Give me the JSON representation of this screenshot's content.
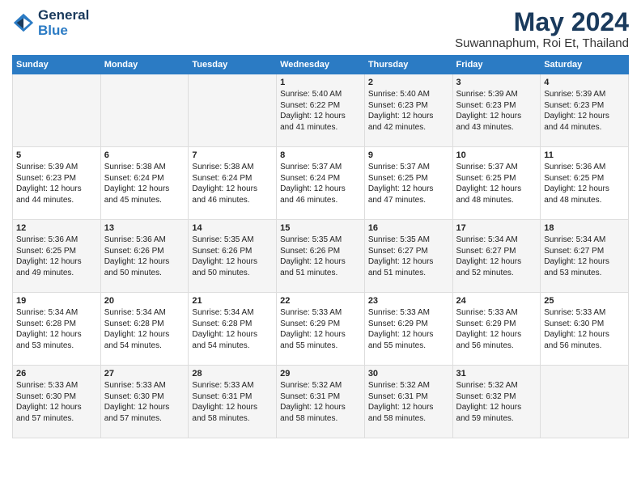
{
  "logo": {
    "line1": "General",
    "line2": "Blue"
  },
  "title": "May 2024",
  "subtitle": "Suwannaphum, Roi Et, Thailand",
  "days_of_week": [
    "Sunday",
    "Monday",
    "Tuesday",
    "Wednesday",
    "Thursday",
    "Friday",
    "Saturday"
  ],
  "weeks": [
    [
      {
        "day": "",
        "info": ""
      },
      {
        "day": "",
        "info": ""
      },
      {
        "day": "",
        "info": ""
      },
      {
        "day": "1",
        "info": "Sunrise: 5:40 AM\nSunset: 6:22 PM\nDaylight: 12 hours\nand 41 minutes."
      },
      {
        "day": "2",
        "info": "Sunrise: 5:40 AM\nSunset: 6:23 PM\nDaylight: 12 hours\nand 42 minutes."
      },
      {
        "day": "3",
        "info": "Sunrise: 5:39 AM\nSunset: 6:23 PM\nDaylight: 12 hours\nand 43 minutes."
      },
      {
        "day": "4",
        "info": "Sunrise: 5:39 AM\nSunset: 6:23 PM\nDaylight: 12 hours\nand 44 minutes."
      }
    ],
    [
      {
        "day": "5",
        "info": "Sunrise: 5:39 AM\nSunset: 6:23 PM\nDaylight: 12 hours\nand 44 minutes."
      },
      {
        "day": "6",
        "info": "Sunrise: 5:38 AM\nSunset: 6:24 PM\nDaylight: 12 hours\nand 45 minutes."
      },
      {
        "day": "7",
        "info": "Sunrise: 5:38 AM\nSunset: 6:24 PM\nDaylight: 12 hours\nand 46 minutes."
      },
      {
        "day": "8",
        "info": "Sunrise: 5:37 AM\nSunset: 6:24 PM\nDaylight: 12 hours\nand 46 minutes."
      },
      {
        "day": "9",
        "info": "Sunrise: 5:37 AM\nSunset: 6:25 PM\nDaylight: 12 hours\nand 47 minutes."
      },
      {
        "day": "10",
        "info": "Sunrise: 5:37 AM\nSunset: 6:25 PM\nDaylight: 12 hours\nand 48 minutes."
      },
      {
        "day": "11",
        "info": "Sunrise: 5:36 AM\nSunset: 6:25 PM\nDaylight: 12 hours\nand 48 minutes."
      }
    ],
    [
      {
        "day": "12",
        "info": "Sunrise: 5:36 AM\nSunset: 6:25 PM\nDaylight: 12 hours\nand 49 minutes."
      },
      {
        "day": "13",
        "info": "Sunrise: 5:36 AM\nSunset: 6:26 PM\nDaylight: 12 hours\nand 50 minutes."
      },
      {
        "day": "14",
        "info": "Sunrise: 5:35 AM\nSunset: 6:26 PM\nDaylight: 12 hours\nand 50 minutes."
      },
      {
        "day": "15",
        "info": "Sunrise: 5:35 AM\nSunset: 6:26 PM\nDaylight: 12 hours\nand 51 minutes."
      },
      {
        "day": "16",
        "info": "Sunrise: 5:35 AM\nSunset: 6:27 PM\nDaylight: 12 hours\nand 51 minutes."
      },
      {
        "day": "17",
        "info": "Sunrise: 5:34 AM\nSunset: 6:27 PM\nDaylight: 12 hours\nand 52 minutes."
      },
      {
        "day": "18",
        "info": "Sunrise: 5:34 AM\nSunset: 6:27 PM\nDaylight: 12 hours\nand 53 minutes."
      }
    ],
    [
      {
        "day": "19",
        "info": "Sunrise: 5:34 AM\nSunset: 6:28 PM\nDaylight: 12 hours\nand 53 minutes."
      },
      {
        "day": "20",
        "info": "Sunrise: 5:34 AM\nSunset: 6:28 PM\nDaylight: 12 hours\nand 54 minutes."
      },
      {
        "day": "21",
        "info": "Sunrise: 5:34 AM\nSunset: 6:28 PM\nDaylight: 12 hours\nand 54 minutes."
      },
      {
        "day": "22",
        "info": "Sunrise: 5:33 AM\nSunset: 6:29 PM\nDaylight: 12 hours\nand 55 minutes."
      },
      {
        "day": "23",
        "info": "Sunrise: 5:33 AM\nSunset: 6:29 PM\nDaylight: 12 hours\nand 55 minutes."
      },
      {
        "day": "24",
        "info": "Sunrise: 5:33 AM\nSunset: 6:29 PM\nDaylight: 12 hours\nand 56 minutes."
      },
      {
        "day": "25",
        "info": "Sunrise: 5:33 AM\nSunset: 6:30 PM\nDaylight: 12 hours\nand 56 minutes."
      }
    ],
    [
      {
        "day": "26",
        "info": "Sunrise: 5:33 AM\nSunset: 6:30 PM\nDaylight: 12 hours\nand 57 minutes."
      },
      {
        "day": "27",
        "info": "Sunrise: 5:33 AM\nSunset: 6:30 PM\nDaylight: 12 hours\nand 57 minutes."
      },
      {
        "day": "28",
        "info": "Sunrise: 5:33 AM\nSunset: 6:31 PM\nDaylight: 12 hours\nand 58 minutes."
      },
      {
        "day": "29",
        "info": "Sunrise: 5:32 AM\nSunset: 6:31 PM\nDaylight: 12 hours\nand 58 minutes."
      },
      {
        "day": "30",
        "info": "Sunrise: 5:32 AM\nSunset: 6:31 PM\nDaylight: 12 hours\nand 58 minutes."
      },
      {
        "day": "31",
        "info": "Sunrise: 5:32 AM\nSunset: 6:32 PM\nDaylight: 12 hours\nand 59 minutes."
      },
      {
        "day": "",
        "info": ""
      }
    ]
  ]
}
